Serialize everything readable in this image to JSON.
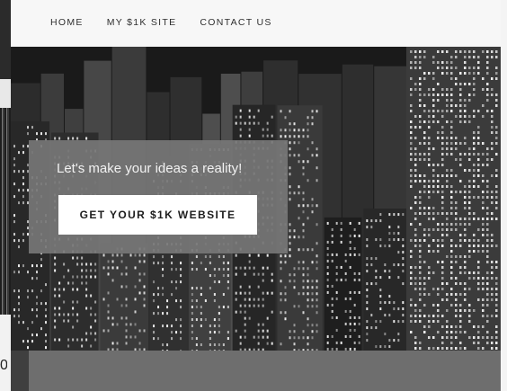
{
  "nav": {
    "items": [
      {
        "label": "HOME"
      },
      {
        "label": "MY $1K SITE"
      },
      {
        "label": "CONTACT US"
      }
    ]
  },
  "hero": {
    "tagline": "Let's make your ideas a reality!",
    "cta_label": "GET YOUR $1K WEBSITE",
    "background": "city-skyline-photo"
  },
  "left_edge": {
    "glyph": "0"
  },
  "colors": {
    "navbar_bg": "#f7f7f7",
    "overlay_bg": "#767676",
    "cta_bg": "#ffffff",
    "bottom_band": "#6e6e6e"
  }
}
